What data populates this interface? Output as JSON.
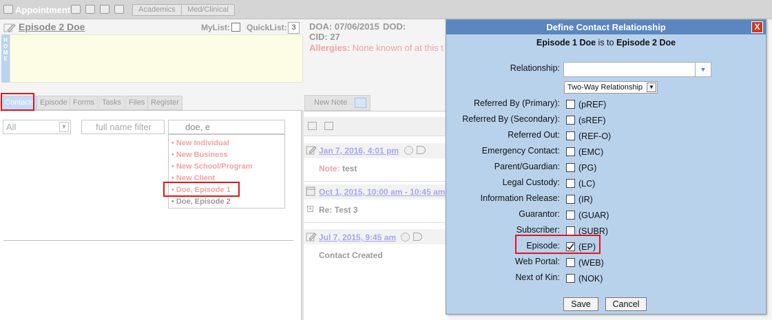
{
  "toolbar": {
    "app_title": "Appointment",
    "tabs": [
      "Academics",
      "Med/Clinical"
    ]
  },
  "header": {
    "client_name": "Episode 2 Doe",
    "mylist_label": "MyList:",
    "quicklist_label": "QuickList:",
    "quicklist_value": "3",
    "doa": "DOA: 07/06/2015",
    "dod": "DOD:",
    "cid": "CID: 27",
    "allergies_label": "Allergies:",
    "allergies_value": "None known of at this t",
    "home_strip": "HOME"
  },
  "left_tabs": [
    "Contacts",
    "Episode",
    "Forms",
    "Tasks",
    "Files",
    "Register"
  ],
  "contacts": {
    "type_select": "All",
    "name_filter_placeholder": "full name filter",
    "search_value": "doe, e",
    "dropdown_items": [
      "• New Individual",
      "• New Business",
      "• New School/Program",
      "• New Client",
      "• Doe, Episode 1",
      "• Doe, Episode 2"
    ]
  },
  "notes": {
    "tab_label": "New Note",
    "entries": [
      {
        "date": "Jan 7, 2016, 4:01 pm",
        "body_label": "Note:",
        "body": "test"
      },
      {
        "date": "Oct 1, 2015, 10:00 am - 10:45 am",
        "body": "Re: Test 3"
      },
      {
        "date": "Jul 7, 2015, 9:45 am",
        "body": "Contact Created"
      }
    ]
  },
  "dialog": {
    "title": "Define Contact Relationship",
    "close": "X",
    "subtitle_a": "Episode 1 Doe",
    "subtitle_mid": " is to ",
    "subtitle_b": "Episode 2 Doe",
    "relationship_label": "Relationship:",
    "relationship_value": "",
    "twoway_value": "Two-Way Relationship",
    "rows": [
      {
        "label": "Referred By (Primary):",
        "code": "(pREF)",
        "checked": false
      },
      {
        "label": "Referred By (Secondary):",
        "code": "(sREF)",
        "checked": false
      },
      {
        "label": "Referred Out:",
        "code": "(REF-O)",
        "checked": false
      },
      {
        "label": "Emergency Contact:",
        "code": "(EMC)",
        "checked": false
      },
      {
        "label": "Parent/Guardian:",
        "code": "(PG)",
        "checked": false
      },
      {
        "label": "Legal Custody:",
        "code": "(LC)",
        "checked": false
      },
      {
        "label": "Information Release:",
        "code": "(IR)",
        "checked": false
      },
      {
        "label": "Guarantor:",
        "code": "(GUAR)",
        "checked": false
      },
      {
        "label": "Subscriber:",
        "code": "(SUBR)",
        "checked": false
      },
      {
        "label": "Episode:",
        "code": "(EP)",
        "checked": true
      },
      {
        "label": "Web Portal:",
        "code": "(WEB)",
        "checked": false
      },
      {
        "label": "Next of Kin:",
        "code": "(NOK)",
        "checked": false
      }
    ],
    "save_label": "Save",
    "cancel_label": "Cancel"
  },
  "colors": {
    "dialog_bg": "#b9d2ec",
    "titlebar": "#5b86c1",
    "highlight": "#e1141b"
  }
}
